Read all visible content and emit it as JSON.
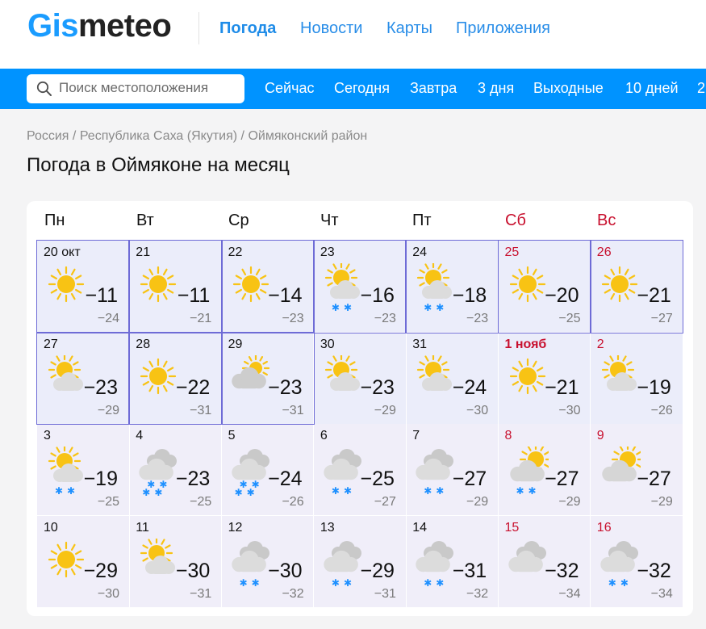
{
  "brand": {
    "logo_part1": "Gis",
    "logo_part2": "meteo"
  },
  "top_nav": [
    "Погода",
    "Новости",
    "Карты",
    "Приложения"
  ],
  "search": {
    "placeholder": "Поиск местоположения"
  },
  "day_nav": [
    "Сейчас",
    "Сегодня",
    "Завтра",
    "3 дня",
    "Выходные",
    "10 дней",
    "2"
  ],
  "breadcrumbs": [
    "Россия",
    "Республика Саха (Якутия)",
    "Оймяконский район"
  ],
  "breadcrumb_sep": "/",
  "page_title": "Погода в Оймяконе на месяц",
  "weekdays": [
    "Пн",
    "Вт",
    "Ср",
    "Чт",
    "Пт",
    "Сб",
    "Вс"
  ],
  "colors": {
    "brand_blue": "#0093ff",
    "weekend_red": "#c8102e",
    "snow_blue": "#1e90ff",
    "sun_yellow": "#f8c314"
  },
  "calendar": [
    [
      {
        "date": "20 окт",
        "icon": "sun",
        "snow": "",
        "tmax": "−11",
        "tmin": "−24"
      },
      {
        "date": "21",
        "icon": "sun",
        "snow": "",
        "tmax": "−11",
        "tmin": "−21"
      },
      {
        "date": "22",
        "icon": "sun",
        "snow": "",
        "tmax": "−14",
        "tmin": "−23"
      },
      {
        "date": "23",
        "icon": "sun-cloud",
        "snow": "**",
        "tmax": "−16",
        "tmin": "−23"
      },
      {
        "date": "24",
        "icon": "sun-cloud",
        "snow": "**",
        "tmax": "−18",
        "tmin": "−23"
      },
      {
        "date": "25",
        "icon": "sun",
        "snow": "",
        "tmax": "−20",
        "tmin": "−25"
      },
      {
        "date": "26",
        "icon": "sun",
        "snow": "",
        "tmax": "−21",
        "tmin": "−27"
      }
    ],
    [
      {
        "date": "27",
        "icon": "sun-cloud",
        "snow": "",
        "tmax": "−23",
        "tmin": "−29"
      },
      {
        "date": "28",
        "icon": "sun",
        "snow": "",
        "tmax": "−22",
        "tmin": "−31"
      },
      {
        "date": "29",
        "icon": "cloud-sun",
        "snow": "",
        "tmax": "−23",
        "tmin": "−31"
      },
      {
        "date": "30",
        "icon": "sun-cloud",
        "snow": "",
        "tmax": "−23",
        "tmin": "−29"
      },
      {
        "date": "31",
        "icon": "sun-cloud",
        "snow": "",
        "tmax": "−24",
        "tmin": "−30"
      },
      {
        "date": "1 нояб",
        "icon": "sun",
        "snow": "",
        "tmax": "−21",
        "tmin": "−30"
      },
      {
        "date": "2",
        "icon": "sun-cloud",
        "snow": "",
        "tmax": "−19",
        "tmin": "−26"
      }
    ],
    [
      {
        "date": "3",
        "icon": "sun-cloud",
        "snow": "**",
        "tmax": "−19",
        "tmin": "−25"
      },
      {
        "date": "4",
        "icon": "cloud",
        "snow": "***",
        "tmax": "−23",
        "tmin": "−25"
      },
      {
        "date": "5",
        "icon": "cloud",
        "snow": "***",
        "tmax": "−24",
        "tmin": "−26"
      },
      {
        "date": "6",
        "icon": "cloud",
        "snow": "**",
        "tmax": "−25",
        "tmin": "−27"
      },
      {
        "date": "7",
        "icon": "cloud",
        "snow": "**",
        "tmax": "−27",
        "tmin": "−29"
      },
      {
        "date": "8",
        "icon": "sun-cloud-big",
        "snow": "**",
        "tmax": "−27",
        "tmin": "−29"
      },
      {
        "date": "9",
        "icon": "sun-cloud-big",
        "snow": "",
        "tmax": "−27",
        "tmin": "−29"
      }
    ],
    [
      {
        "date": "10",
        "icon": "sun",
        "snow": "",
        "tmax": "−29",
        "tmin": "−30"
      },
      {
        "date": "11",
        "icon": "sun-cloud",
        "snow": "",
        "tmax": "−30",
        "tmin": "−31"
      },
      {
        "date": "12",
        "icon": "cloud",
        "snow": "**",
        "tmax": "−30",
        "tmin": "−32"
      },
      {
        "date": "13",
        "icon": "cloud",
        "snow": "**",
        "tmax": "−29",
        "tmin": "−31"
      },
      {
        "date": "14",
        "icon": "cloud",
        "snow": "**",
        "tmax": "−31",
        "tmin": "−32"
      },
      {
        "date": "15",
        "icon": "cloud",
        "snow": "",
        "tmax": "−32",
        "tmin": "−34"
      },
      {
        "date": "16",
        "icon": "cloud",
        "snow": "**",
        "tmax": "−32",
        "tmin": "−34"
      }
    ]
  ]
}
